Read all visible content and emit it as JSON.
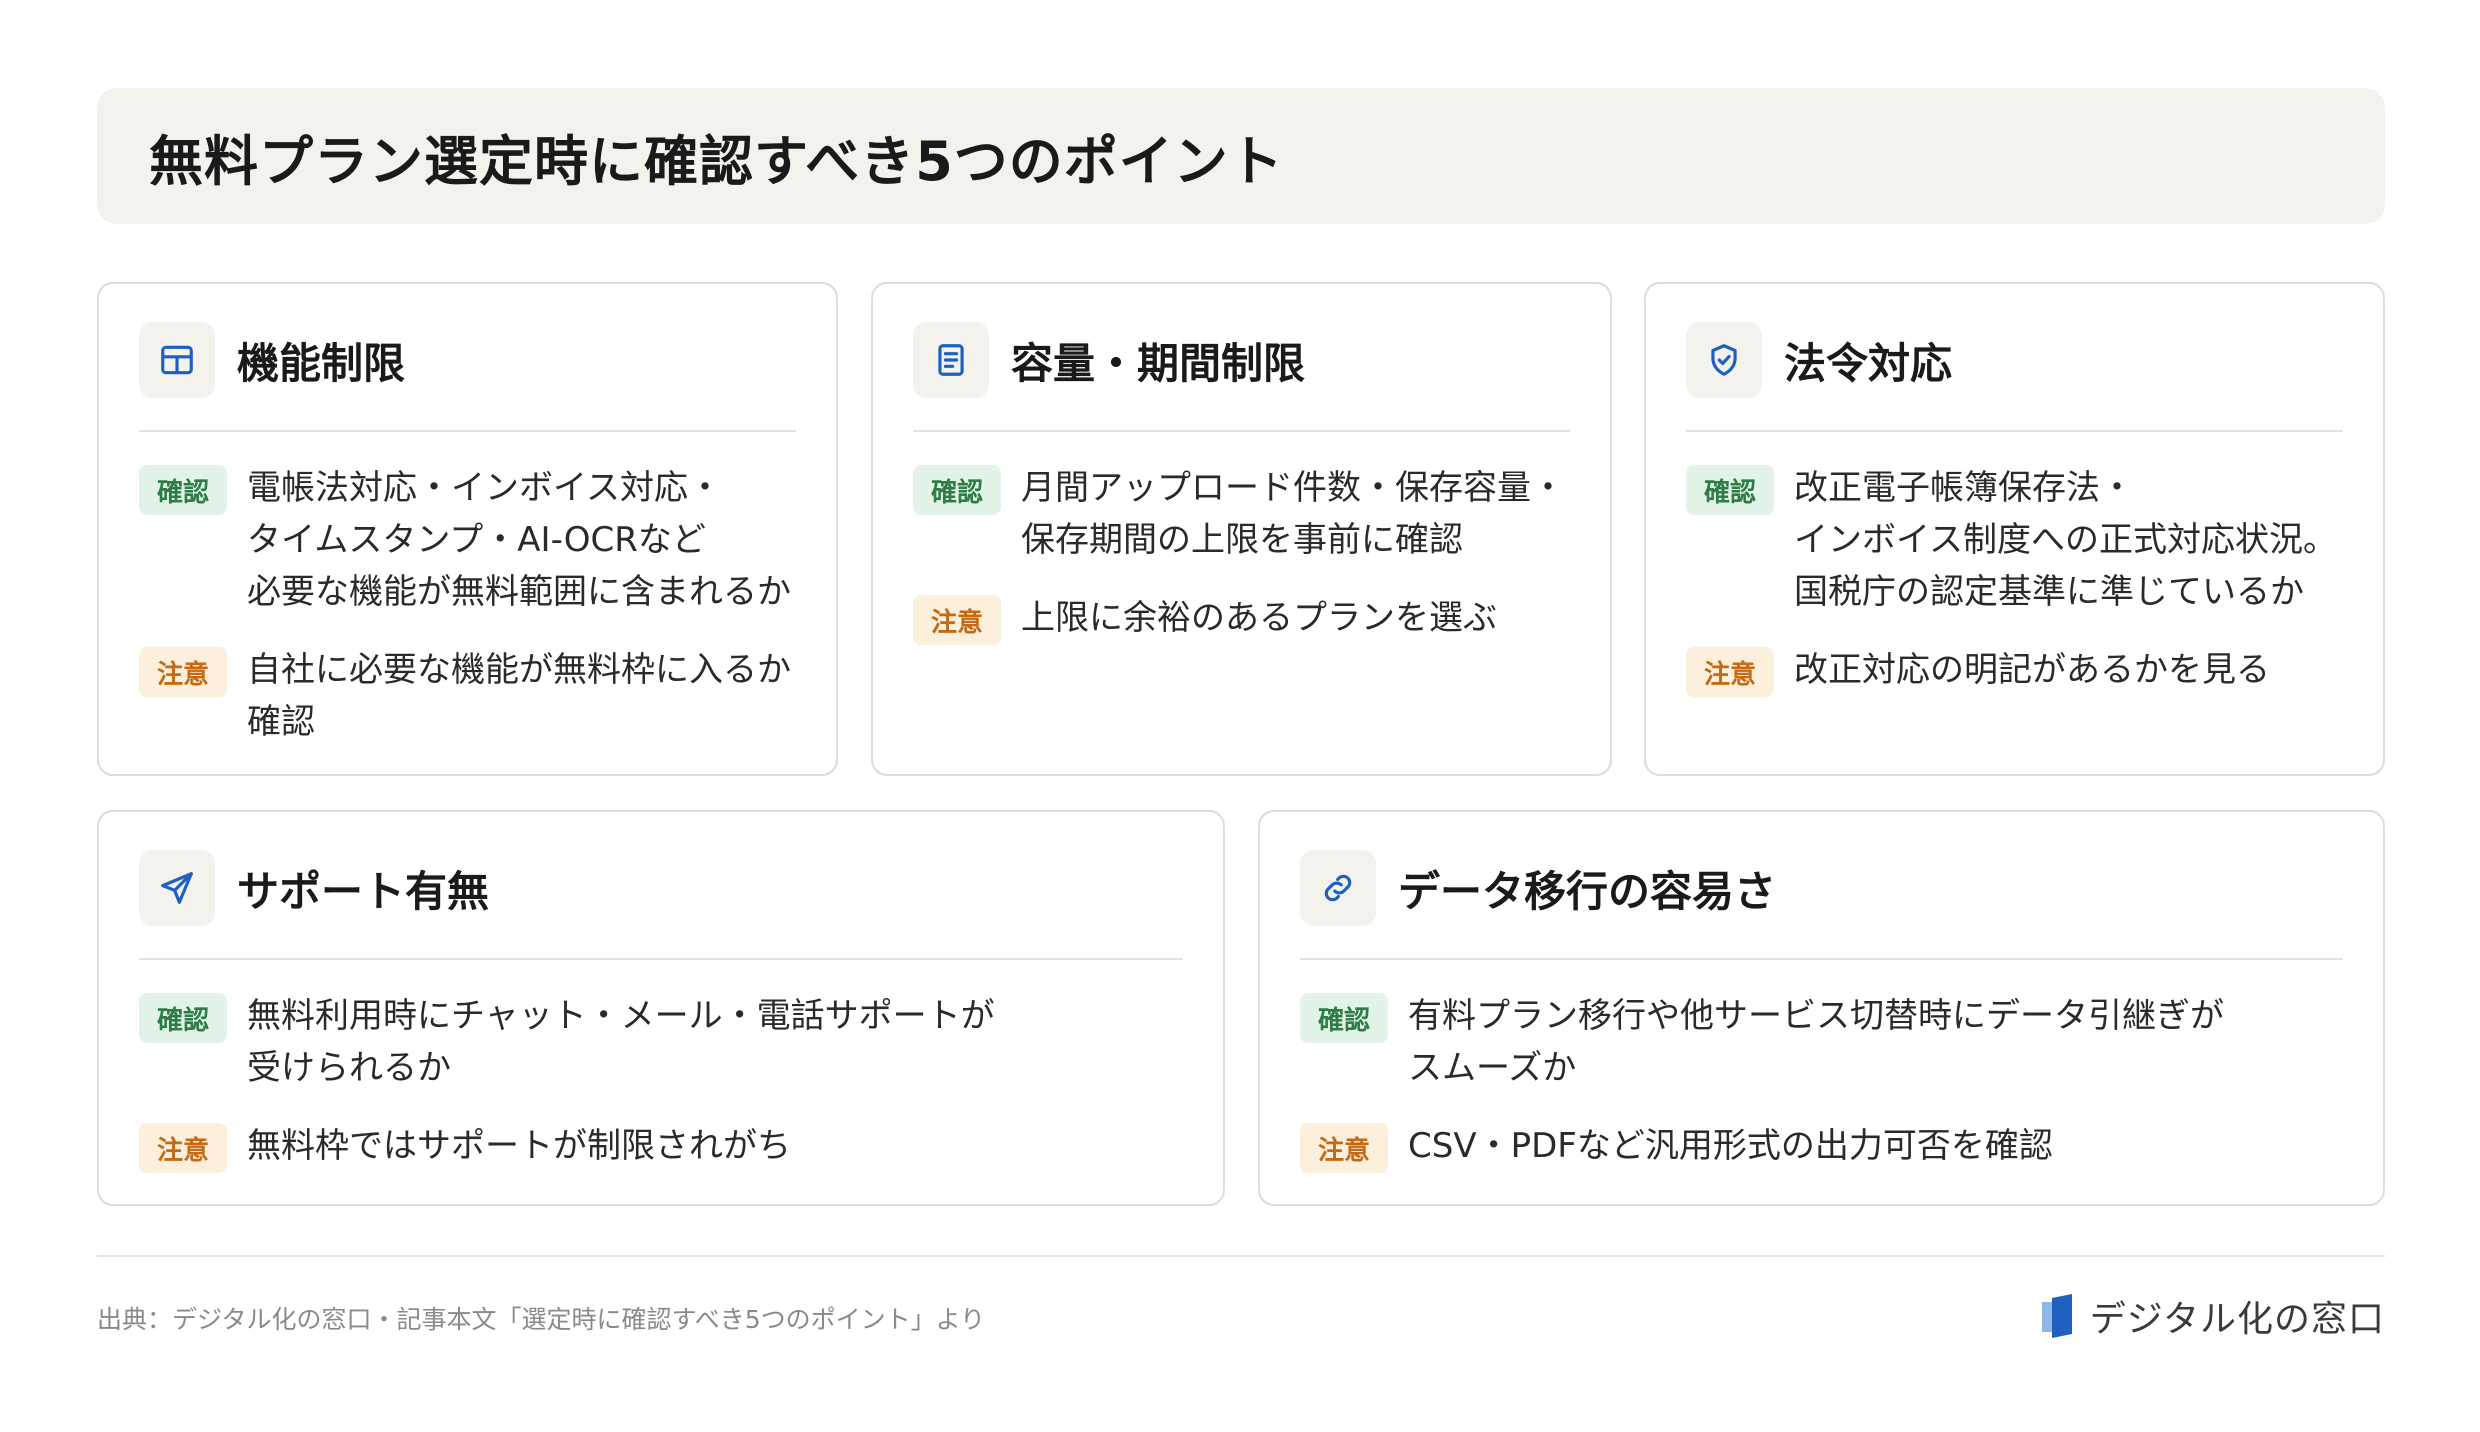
{
  "title": "無料プラン選定時に確認すべき5つのポイント",
  "badges": {
    "check": "確認",
    "caution": "注意"
  },
  "cards": [
    {
      "title": "機能制限",
      "icon": "grid-icon",
      "check": "電帳法対応・インボイス対応・\nタイムスタンプ・AI-OCRなど\n必要な機能が無料範囲に含まれるか",
      "caution": "自社に必要な機能が無料枠に入るか\n確認"
    },
    {
      "title": "容量・期間制限",
      "icon": "document-icon",
      "check": "月間アップロード件数・保存容量・\n保存期間の上限を事前に確認",
      "caution": "上限に余裕のあるプランを選ぶ"
    },
    {
      "title": "法令対応",
      "icon": "shield-check-icon",
      "check": "改正電子帳簿保存法・\nインボイス制度への正式対応状況。\n国税庁の認定基準に準じているか",
      "caution": "改正対応の明記があるかを見る"
    },
    {
      "title": "サポート有無",
      "icon": "send-icon",
      "check": "無料利用時にチャット・メール・電話サポートが\n受けられるか",
      "caution": "無料枠ではサポートが制限されがち"
    },
    {
      "title": "データ移行の容易さ",
      "icon": "link-icon",
      "check": "有料プラン移行や他サービス切替時にデータ引継ぎが\nスムーズか",
      "caution": "CSV・PDFなど汎用形式の出力可否を確認"
    }
  ],
  "footer": {
    "source": "出典：デジタル化の窓口・記事本文「選定時に確認すべき5つのポイント」より",
    "brand": "デジタル化の窓口"
  },
  "colors": {
    "accent": "#1f5fbf",
    "check_badge_bg": "#e4f3e8",
    "check_badge_text": "#2e7d46",
    "caution_badge_bg": "#fcefdc",
    "caution_badge_text": "#c56a14"
  }
}
